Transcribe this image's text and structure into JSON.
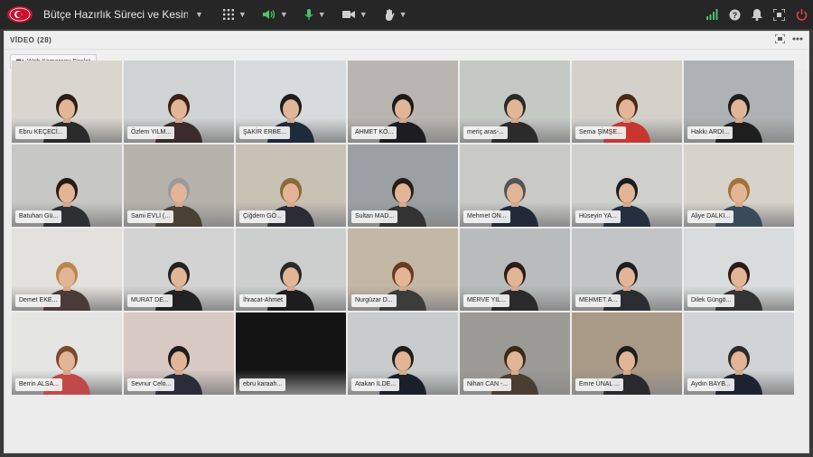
{
  "app": {
    "meeting_title": "Bütçe Hazırlık Süreci ve Kesin He...",
    "icons": [
      "apps-grid-icon",
      "speaker-icon",
      "microphone-icon",
      "camera-icon",
      "raise-hand-icon",
      "signal-icon",
      "help-icon",
      "notification-icon",
      "fullscreen-icon",
      "power-icon"
    ]
  },
  "panel": {
    "title": "VİDEO (28)",
    "camera_button": "Web Kameramı Başlat"
  },
  "participants": [
    {
      "name": "Ebru KEÇECİ...",
      "wall": "#d9d6d0",
      "shirt": "#2a2a2a",
      "hair": "#2b1d14"
    },
    {
      "name": "Özlem YILM...",
      "wall": "#cfd3d3",
      "shirt": "#3b2b2a",
      "hair": "#3a2114"
    },
    {
      "name": "ŞAKİR ERBE...",
      "wall": "#d7dbdd",
      "shirt": "#1f2a3c",
      "hair": "#1d1d1d"
    },
    {
      "name": "AHMET KÖ...",
      "wall": "#b9b6b1",
      "shirt": "#1c1c22",
      "hair": "#1a1a1a"
    },
    {
      "name": "meriç aras-...",
      "wall": "#c5c9c4",
      "shirt": "#2b2b2b",
      "hair": "#2a2a2a"
    },
    {
      "name": "Sema ŞİMŞE...",
      "wall": "#d4d1cb",
      "shirt": "#c7372f",
      "hair": "#4a2a16"
    },
    {
      "name": "Hakkı ARDI...",
      "wall": "#aeb2b4",
      "shirt": "#1e1e1e",
      "hair": "#1e1e1e"
    },
    {
      "name": "Batuhan Gü...",
      "wall": "#c7c7c5",
      "shirt": "#2d2f33",
      "hair": "#2a1b12"
    },
    {
      "name": "Sami EVLİ (...",
      "wall": "#b5b2ab",
      "shirt": "#4a4034",
      "hair": "#9a9a9a"
    },
    {
      "name": "Çiğdem GÖ...",
      "wall": "#c8c2b5",
      "shirt": "#2c2c36",
      "hair": "#8a6a3a"
    },
    {
      "name": "Sultan MAD...",
      "wall": "#9aa0a3",
      "shirt": "#333",
      "hair": "#2a1c14"
    },
    {
      "name": "Mehmet ÖN...",
      "wall": "#c9c9c6",
      "shirt": "#222a3a",
      "hair": "#555"
    },
    {
      "name": "Hüseyin YA...",
      "wall": "#cfcfcc",
      "shirt": "#24303f",
      "hair": "#1d1d1d"
    },
    {
      "name": "Aliye DALKI...",
      "wall": "#d6d3cb",
      "shirt": "#3b4a5a",
      "hair": "#a47238"
    },
    {
      "name": "Demet EKE...",
      "wall": "#e3e1dd",
      "shirt": "#4a3a3a",
      "hair": "#b9874e"
    },
    {
      "name": "MURAT DE...",
      "wall": "#d3d3d3",
      "shirt": "#222",
      "hair": "#222"
    },
    {
      "name": "İhracat-Ahmet",
      "wall": "#cdcfcf",
      "shirt": "#1d1d1d",
      "hair": "#2a2a2a"
    },
    {
      "name": "Nurgüzar D...",
      "wall": "#c3b7a5",
      "shirt": "#3c3c3c",
      "hair": "#6a3a1e"
    },
    {
      "name": "MERVE YIL...",
      "wall": "#b9bcbd",
      "shirt": "#2a2a2a",
      "hair": "#2b1d14"
    },
    {
      "name": "MEHMET A...",
      "wall": "#c2c4c5",
      "shirt": "#2b2d33",
      "hair": "#1d1d1d"
    },
    {
      "name": "Dilek Güngö...",
      "wall": "#d9dcdc",
      "shirt": "#333",
      "hair": "#2a1a12"
    },
    {
      "name": "Berrin ALSA...",
      "wall": "#e5e5e3",
      "shirt": "#c04a4a",
      "hair": "#7a4a2a"
    },
    {
      "name": "Sevnur Celo...",
      "wall": "#d9c9c5",
      "shirt": "#2b2b3a",
      "hair": "#1d1d1d"
    },
    {
      "name": "ebru karaah...",
      "wall": "#141414",
      "shirt": "#141414",
      "hair": "#141414"
    },
    {
      "name": "Atakan İLDE...",
      "wall": "#c9cbcd",
      "shirt": "#1b1f2a",
      "hair": "#1d1d1d"
    },
    {
      "name": "Nihan CAN -...",
      "wall": "#9c9a94",
      "shirt": "#4a3e32",
      "hair": "#3a2a1a"
    },
    {
      "name": "Emre ÜNAL ...",
      "wall": "#a89a86",
      "shirt": "#2a2a2e",
      "hair": "#1d1d1d"
    },
    {
      "name": "Aydın BAYB...",
      "wall": "#d1d3d6",
      "shirt": "#1e2230",
      "hair": "#2a2a2a"
    }
  ]
}
